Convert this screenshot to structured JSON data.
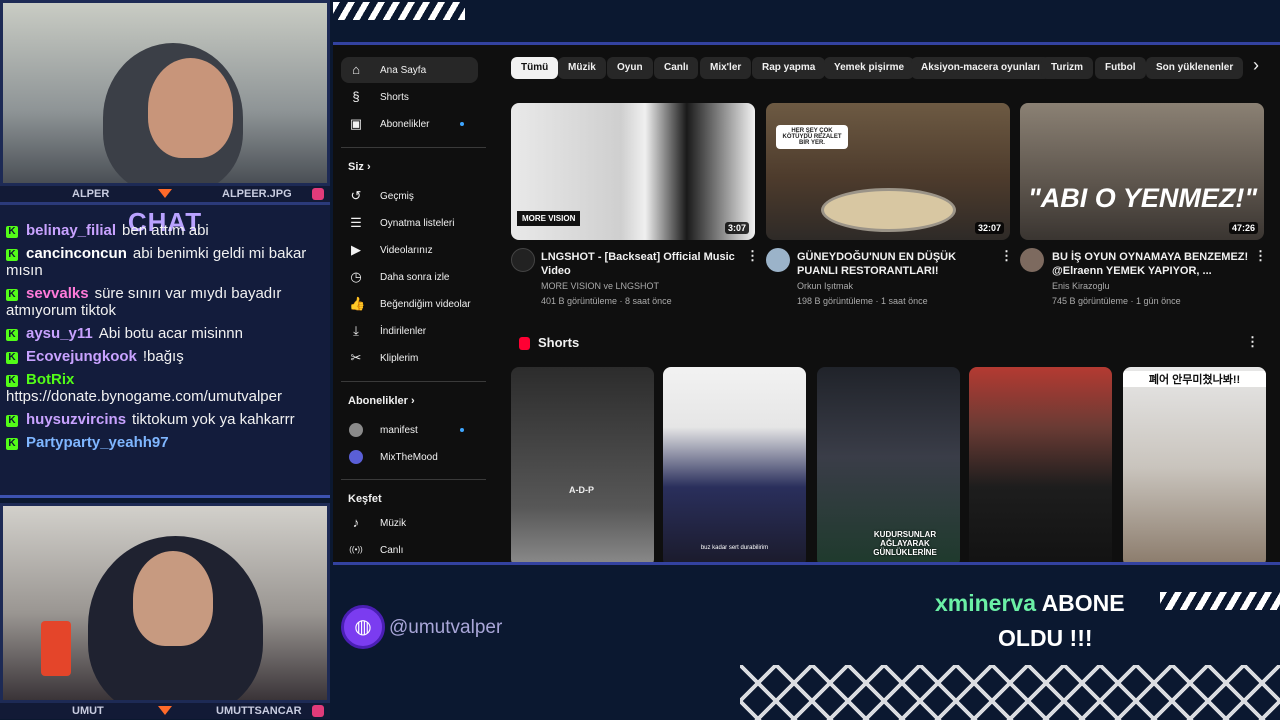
{
  "colors": {
    "background": "#0b1830",
    "accent_blue": "#3342a0",
    "kick_green": "#53fc18",
    "chat_title": "#b9a2ff",
    "alert_green": "#6bf0a6",
    "youtube_bg": "#0f0f0f"
  },
  "camera_top": {
    "left_name": "ALPER",
    "right_name": "ALPEER.JPG"
  },
  "camera_bottom": {
    "left_name": "UMUT",
    "right_name": "UMUTTSANCAR"
  },
  "chat": {
    "title": "CHAT",
    "messages": [
      {
        "user": "belinay_filial",
        "user_color": "#c8a2ff",
        "text": "ben attım abi"
      },
      {
        "user": "cancinconcun",
        "user_color": "#ffffff",
        "text": "abi benimki geldi mi bakar mısın"
      },
      {
        "user": "sevvalks",
        "user_color": "#ff7ad9",
        "text": "süre sınırı var mıydı bayadır atmıyorum tiktok"
      },
      {
        "user": "aysu_y11",
        "user_color": "#c8a2ff",
        "text": "Abi botu acar misinnn"
      },
      {
        "user": "Ecovejungkook",
        "user_color": "#c8a2ff",
        "text": "!bağış"
      },
      {
        "user": "BotRix",
        "user_color": "#53fc18",
        "text": "https://donate.bynogame.com/umutvalper"
      },
      {
        "user": "huysuzvircins",
        "user_color": "#c8a2ff",
        "text": "tiktokum yok ya kahkarrr"
      },
      {
        "user": "Partyparty_yeahh97",
        "user_color": "#7fb6ff",
        "text": ""
      }
    ]
  },
  "youtube": {
    "sidebar": {
      "main": [
        {
          "icon": "home-icon",
          "glyph": "⌂",
          "label": "Ana Sayfa",
          "active": true
        },
        {
          "icon": "shorts-icon",
          "glyph": "§",
          "label": "Shorts"
        },
        {
          "icon": "subscriptions-icon",
          "glyph": "▣",
          "label": "Abonelikler",
          "dot": true
        }
      ],
      "you_heading": "Siz",
      "you": [
        {
          "icon": "history-icon",
          "glyph": "↺",
          "label": "Geçmiş"
        },
        {
          "icon": "playlist-icon",
          "glyph": "☰",
          "label": "Oynatma listeleri"
        },
        {
          "icon": "your-videos-icon",
          "glyph": "▶",
          "label": "Videolarınız"
        },
        {
          "icon": "watch-later-icon",
          "glyph": "◷",
          "label": "Daha sonra izle"
        },
        {
          "icon": "like-icon",
          "glyph": "👍",
          "label": "Beğendiğim videolar"
        },
        {
          "icon": "download-icon",
          "glyph": "⤓",
          "label": "İndirilenler"
        },
        {
          "icon": "clips-icon",
          "glyph": "✂",
          "label": "Kliplerim"
        }
      ],
      "subs_heading": "Abonelikler",
      "subs": [
        {
          "icon": "channel-avatar-icon",
          "label": "manifest",
          "dot": true
        },
        {
          "icon": "channel-avatar-icon",
          "label": "MixTheMood"
        }
      ],
      "explore_heading": "Keşfet",
      "explore": [
        {
          "icon": "music-icon",
          "glyph": "♪",
          "label": "Müzik"
        },
        {
          "icon": "live-icon",
          "glyph": "((•))",
          "label": "Canlı"
        }
      ]
    },
    "chips": [
      "Tümü",
      "Müzik",
      "Oyun",
      "Canlı",
      "Mix'ler",
      "Rap yapma",
      "Yemek pişirme",
      "Aksiyon-macera oyunları",
      "Turizm",
      "Futbol",
      "Son yüklenenler"
    ],
    "videos": [
      {
        "title": "LNGSHOT - [Backseat] Official Music Video",
        "channel": "MORE VISION ve LNGSHOT",
        "meta": "401 B görüntüleme · 8 saat önce",
        "duration": "3:07",
        "overlay": "MORE VISION"
      },
      {
        "title": "GÜNEYDOĞU'NUN EN DÜŞÜK PUANLI RESTORANTLARI!",
        "channel": "Orkun Işıtmak",
        "meta": "198 B görüntüleme · 1 saat önce",
        "duration": "32:07",
        "overlay": "HER ŞEY ÇOK KÖTÜYDÜ REZALET BİR YER."
      },
      {
        "title": "BU İŞ OYUN OYNAMAYA BENZEMEZ! @Elraenn YEMEK YAPIYOR, ...",
        "channel": "Enis Kirazoglu",
        "meta": "745 B görüntüleme · 1 gün önce",
        "duration": "47:26",
        "overlay": "\"ABI O YENMEZ!\""
      }
    ],
    "shorts_heading": "Shorts",
    "shorts": [
      {
        "caption": "A-D-P"
      },
      {
        "caption": "buz kadar sert durabilirim"
      },
      {
        "caption": "KUDURSUNLAR AĞLAYARAK GÜNLÜKLERİNE"
      },
      {
        "caption": ""
      },
      {
        "caption": "폐어 안무미쳤나봐!!"
      }
    ]
  },
  "footer": {
    "handle": "@umutvalper",
    "alert_user": "xminerva",
    "alert_line1": "ABONE",
    "alert_line2": "OLDU !!!"
  }
}
